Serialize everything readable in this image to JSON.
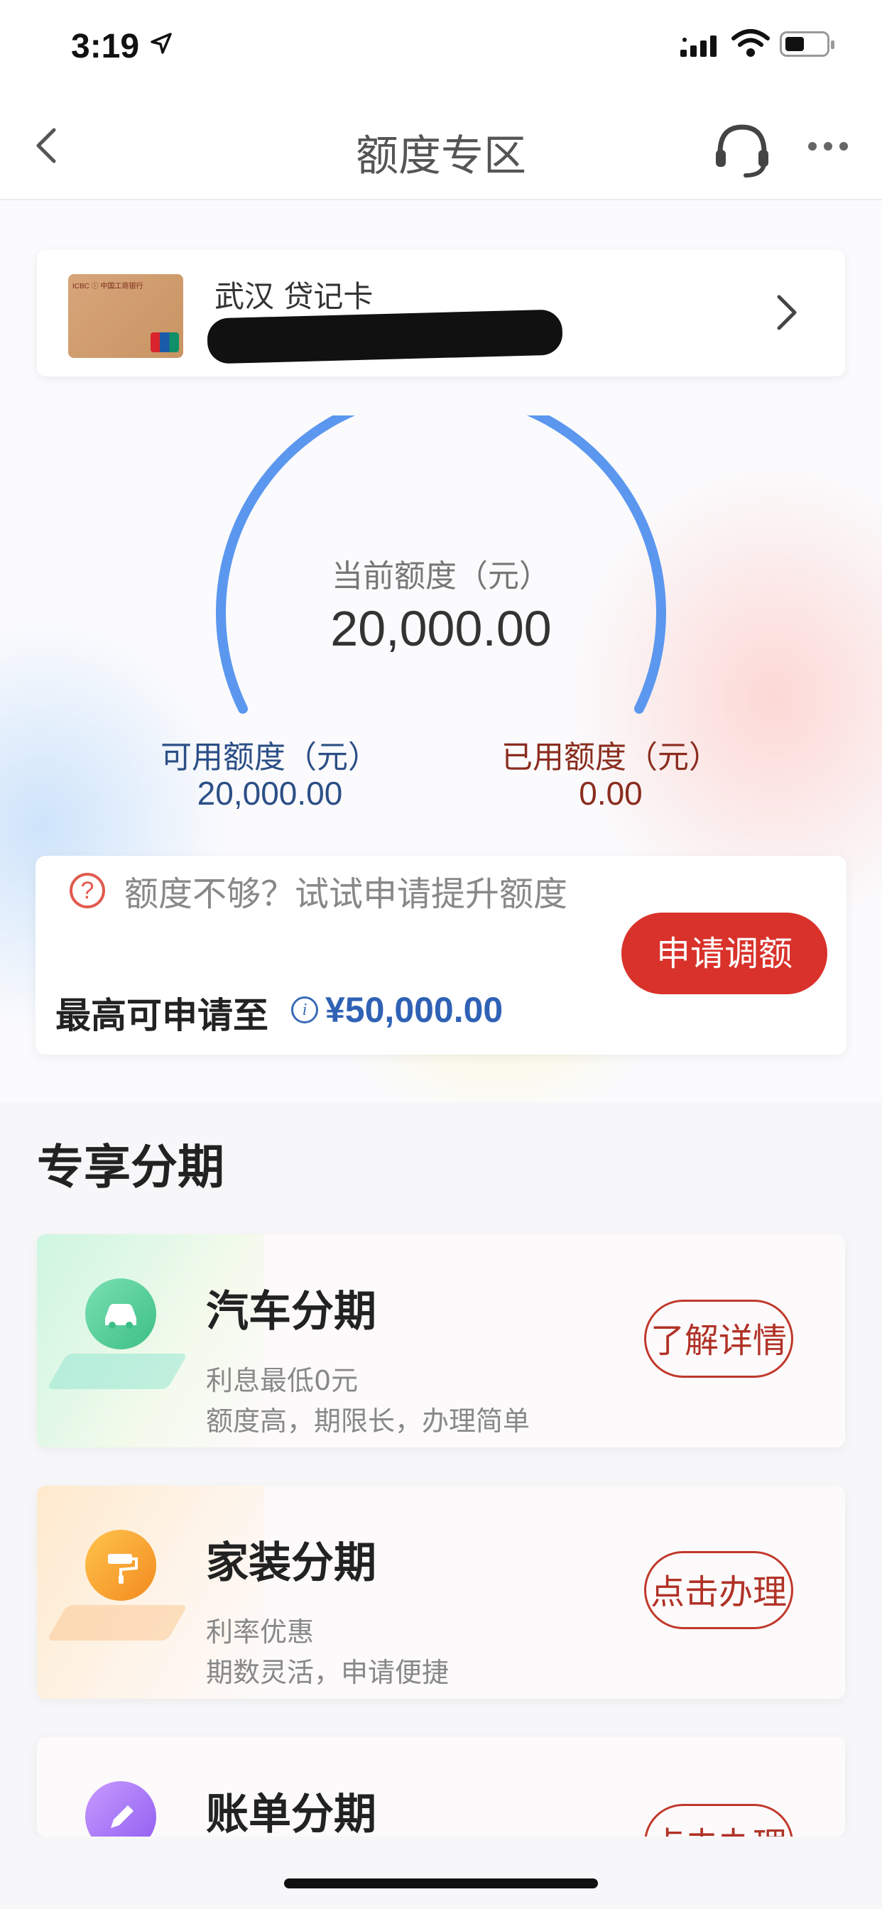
{
  "status_bar": {
    "time": "3:19",
    "location_icon": "location-arrow-icon",
    "signal_icon": "signal-icon",
    "wifi_icon": "wifi-icon",
    "battery_icon": "battery-icon"
  },
  "nav": {
    "title": "额度专区",
    "back_icon": "chevron-left-icon",
    "service_icon": "headset-icon",
    "more_icon": "more-icon"
  },
  "card": {
    "name": "武汉 贷记卡",
    "chevron_icon": "chevron-right-icon"
  },
  "limits": {
    "current_label": "当前额度（元）",
    "current_value": "20,000.00",
    "available_label": "可用额度（元）",
    "available_value": "20,000.00",
    "used_label": "已用额度（元）",
    "used_value": "0.00"
  },
  "raise": {
    "text": "额度不够？试试申请提升额度",
    "max_label": "最高可申请至",
    "max_value": "¥50,000.00",
    "button": "申请调额"
  },
  "section": {
    "title": "专享分期"
  },
  "products": [
    {
      "title": "汽车分期",
      "line1": "利息最低0元",
      "line2": "额度高，期限长，办理简单",
      "button": "了解详情",
      "icon": "car-icon"
    },
    {
      "title": "家装分期",
      "line1": "利率优惠",
      "line2": "期数灵活，申请便捷",
      "button": "点击办理",
      "icon": "paint-roller-icon"
    },
    {
      "title": "账单分期",
      "button": "点击办理",
      "icon": "pencil-icon"
    }
  ],
  "colors": {
    "accent_red": "#d9322b",
    "gauge_blue": "#5b97ef",
    "available_blue": "#2c4f86",
    "used_brown": "#8a2d1f",
    "max_blue": "#2f62b5"
  }
}
